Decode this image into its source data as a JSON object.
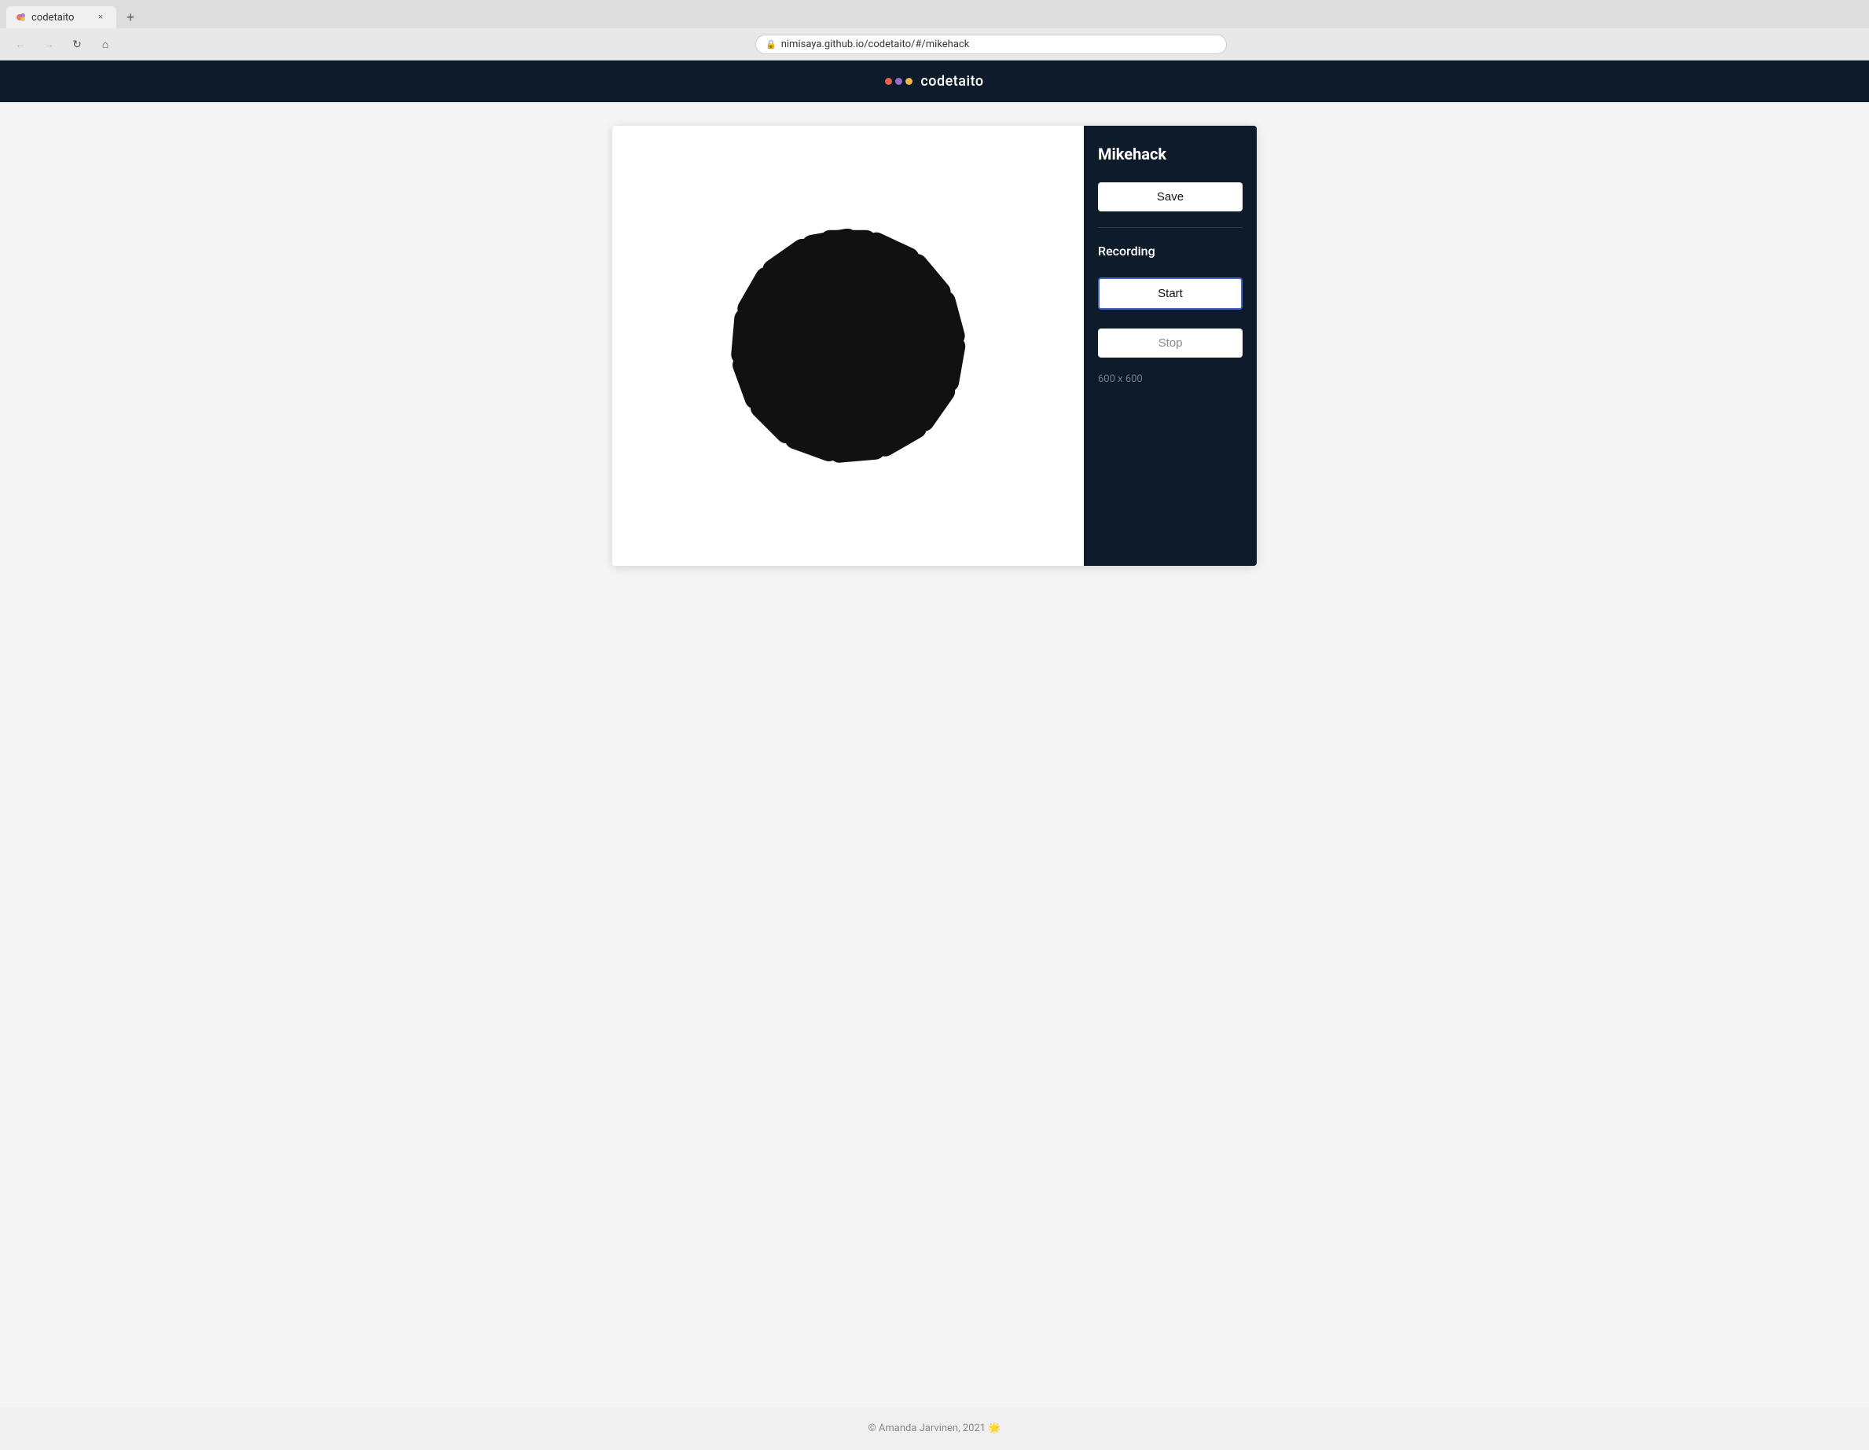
{
  "browser": {
    "tab_title": "codetaito",
    "tab_close_label": "×",
    "tab_new_label": "+",
    "nav_back": "←",
    "nav_forward": "→",
    "nav_refresh": "↻",
    "nav_home": "⌂",
    "address": "nimisaya.github.io/codetaito/#/mikehack",
    "lock_symbol": "🔒"
  },
  "header": {
    "site_title": "codetaito",
    "logo_dots": [
      {
        "color": "#e8634a"
      },
      {
        "color": "#9b6bcc"
      },
      {
        "color": "#e8b84b"
      }
    ]
  },
  "sidebar": {
    "project_title": "Mikehack",
    "save_label": "Save",
    "recording_label": "Recording",
    "start_label": "Start",
    "stop_label": "Stop",
    "canvas_size": "600 x 600"
  },
  "footer": {
    "copyright": "© Amanda Jarvinen, 2021",
    "emoji": "🌟"
  }
}
